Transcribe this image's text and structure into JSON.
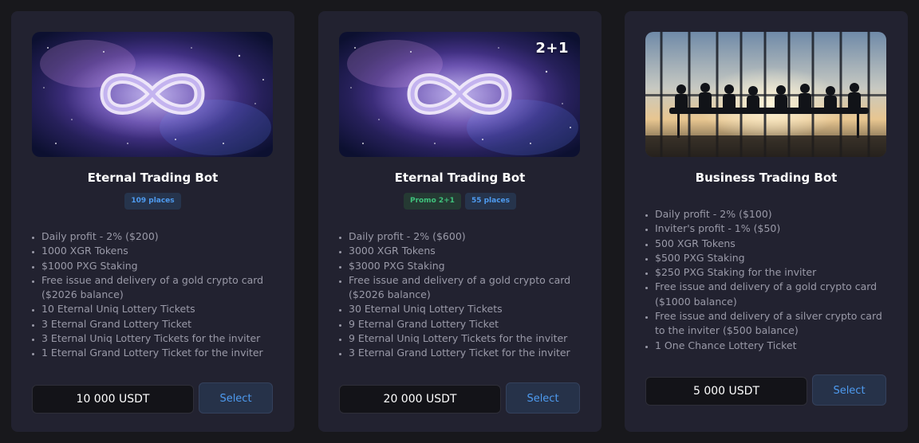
{
  "cards": [
    {
      "title": "Eternal Trading Bot",
      "image": "infinity-galaxy",
      "overlay": "",
      "badges": [
        {
          "label": "109 places",
          "kind": "places"
        }
      ],
      "features": [
        "Daily profit - 2% ($200)",
        "1000 XGR Tokens",
        "$1000 PXG Staking",
        "Free issue and delivery of a gold crypto card ($2026 balance)",
        "10 Eternal Uniq Lottery Tickets",
        "3 Eternal Grand Lottery Ticket",
        "3 Eternal Uniq Lottery Tickets for the inviter",
        "1 Eternal Grand Lottery Ticket for the inviter"
      ],
      "price": "10 000 USDT",
      "select_label": "Select"
    },
    {
      "title": "Eternal Trading Bot",
      "image": "infinity-galaxy",
      "overlay": "2+1",
      "badges": [
        {
          "label": "Promo 2+1",
          "kind": "promo"
        },
        {
          "label": "55 places",
          "kind": "places"
        }
      ],
      "features": [
        "Daily profit - 2% ($600)",
        "3000 XGR Tokens",
        "$3000 PXG Staking",
        "Free issue and delivery of a gold crypto card ($2026 balance)",
        "30 Eternal Uniq Lottery Tickets",
        "9 Eternal Grand Lottery Ticket",
        "9 Eternal Uniq Lottery Tickets for the inviter",
        "3 Eternal Grand Lottery Ticket for the inviter"
      ],
      "price": "20 000 USDT",
      "select_label": "Select"
    },
    {
      "title": "Business Trading Bot",
      "image": "business-meeting",
      "overlay": "",
      "badges": [],
      "features": [
        "Daily profit - 2% ($100)",
        "Inviter's profit - 1% ($50)",
        "500 XGR Tokens",
        "$500 PXG Staking",
        "$250 PXG Staking for the inviter",
        "Free issue and delivery of a gold crypto card ($1000 balance)",
        "Free issue and delivery of a silver crypto card to the inviter ($500 balance)",
        "1 One Chance Lottery Ticket"
      ],
      "price": "5 000 USDT",
      "select_label": "Select"
    }
  ],
  "colors": {
    "background": "#18181c",
    "card": "#222230",
    "accent_blue": "#4e9bf0",
    "promo_green": "#3fc27c"
  }
}
